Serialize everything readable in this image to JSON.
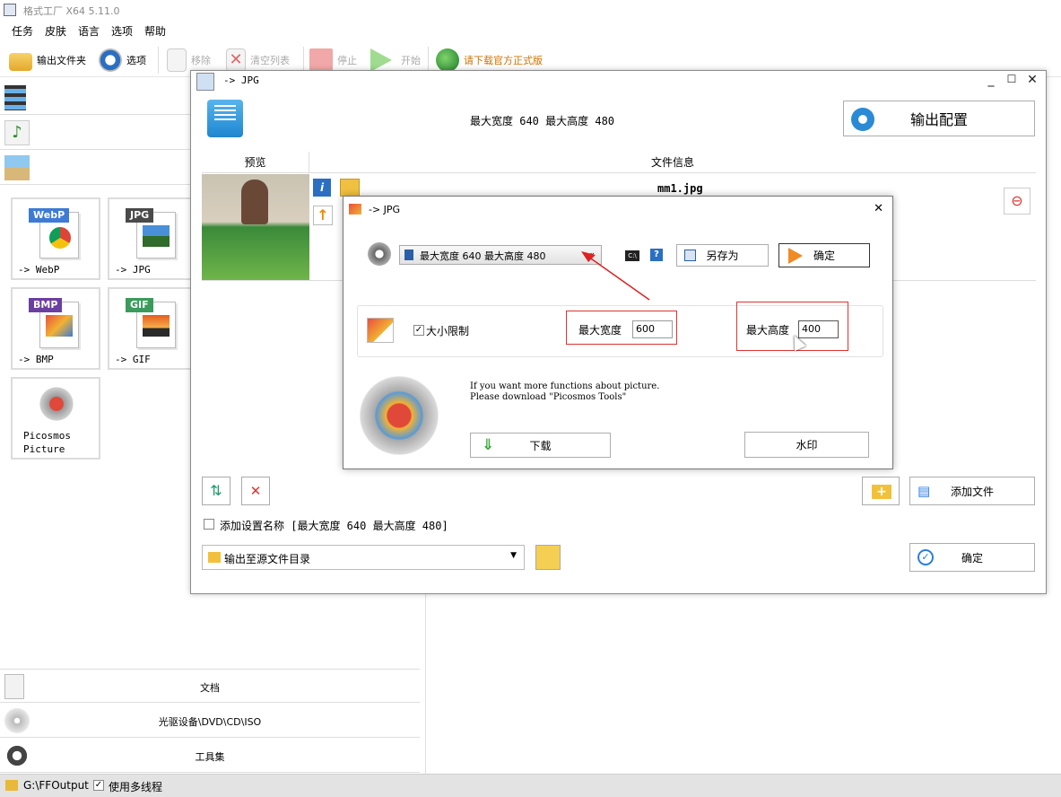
{
  "app": {
    "title": "格式工厂 X64 5.11.0"
  },
  "menu": [
    "任务",
    "皮肤",
    "语言",
    "选项",
    "帮助"
  ],
  "toolbar": {
    "output_folder": "输出文件夹",
    "options": "选项",
    "remove": "移除",
    "clear_list": "清空列表",
    "stop": "停止",
    "start": "开始",
    "download_official": "请下载官方正式版"
  },
  "left_tiles": [
    {
      "badge": "WebP",
      "label": "-> WebP",
      "color": "#3d7bd4"
    },
    {
      "badge": "JPG",
      "label": "-> JPG",
      "color": "#4a4a4a"
    },
    {
      "badge": "BMP",
      "label": "-> BMP",
      "color": "#6b3fa0"
    },
    {
      "badge": "GIF",
      "label": "-> GIF",
      "color": "#3a9b5c"
    },
    {
      "badge": "",
      "label": "Picosmos\nPicture",
      "color": ""
    }
  ],
  "left_categories": [
    "文档",
    "光驱设备\\DVD\\CD\\ISO",
    "工具集"
  ],
  "statusbar": {
    "path": "G:\\FFOutput",
    "multithread": "使用多线程"
  },
  "dialog1": {
    "title": "-> JPG",
    "setting_summary": "最大宽度 640 最大高度 480",
    "output_config": "输出配置",
    "col_preview": "预览",
    "col_fileinfo": "文件信息",
    "file_name": "mm1.jpg",
    "add_setting_name": "添加设置名称 [最大宽度 640 最大高度 480]",
    "output_dir": "输出至源文件目录",
    "add_file": "添加文件",
    "ok": "确定"
  },
  "dialog2": {
    "title": "-> JPG",
    "preset": "最大宽度 640 最大高度 480",
    "save_as": "另存为",
    "ok": "确定",
    "size_limit": "大小限制",
    "max_width_label": "最大宽度",
    "max_width_value": "600",
    "max_height_label": "最大高度",
    "max_height_value": "400",
    "promo_line1": "If you want more functions about picture.",
    "promo_line2": "Please download \"Picosmos Tools\"",
    "download": "下载",
    "watermark": "水印"
  },
  "colors": {
    "accent": "#2a7de1",
    "annotation_red": "#dd2222",
    "toolbar_green": "#1a9a3a"
  }
}
